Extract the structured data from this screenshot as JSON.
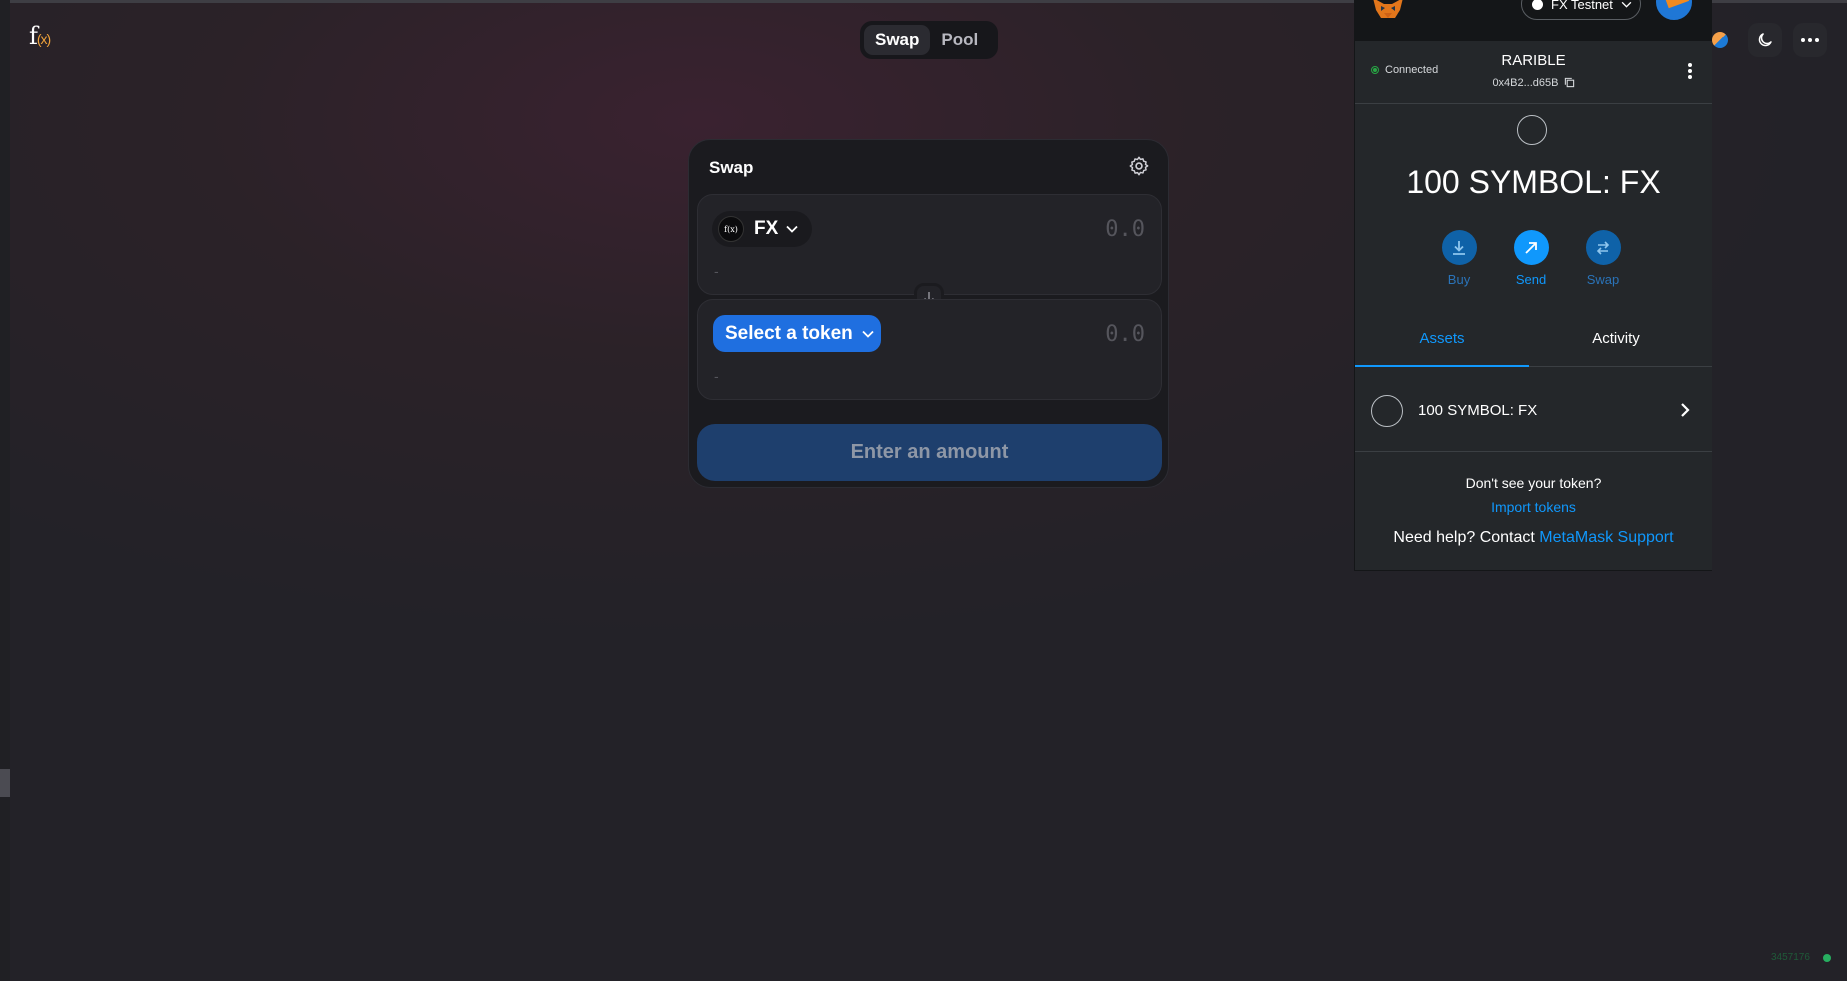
{
  "app": {
    "logo_main": "f",
    "logo_sub": "(x)",
    "nav_tabs": [
      {
        "label": "Swap",
        "active": true
      },
      {
        "label": "Pool",
        "active": false
      }
    ],
    "right_icons": [
      "theme-moon-icon",
      "more-dots-icon"
    ]
  },
  "swap": {
    "title": "Swap",
    "from": {
      "token_icon_text": "f(x)",
      "token": "FX",
      "amount_placeholder": "0.0",
      "usd": "-"
    },
    "to": {
      "select_label": "Select a token",
      "amount_placeholder": "0.0",
      "usd": "-"
    },
    "submit_label": "Enter an amount"
  },
  "metamask": {
    "network": "FX Testnet",
    "status": "Connected",
    "account_name": "RARIBLE",
    "address": "0x4B2...d65B",
    "balance": "100 SYMBOL: FX",
    "actions": [
      {
        "label": "Buy"
      },
      {
        "label": "Send"
      },
      {
        "label": "Swap"
      }
    ],
    "tabs": [
      {
        "label": "Assets",
        "active": true
      },
      {
        "label": "Activity",
        "active": false
      }
    ],
    "asset": {
      "label": "100 SYMBOL: FX"
    },
    "dont_see": "Don't see your token?",
    "import_link": "Import tokens",
    "help_prefix": "Need help? Contact",
    "help_link": "MetaMask Support",
    "colors": {
      "accent": "#1098fc",
      "background": "#24272a"
    }
  },
  "footer": {
    "block_number": "3457176"
  }
}
